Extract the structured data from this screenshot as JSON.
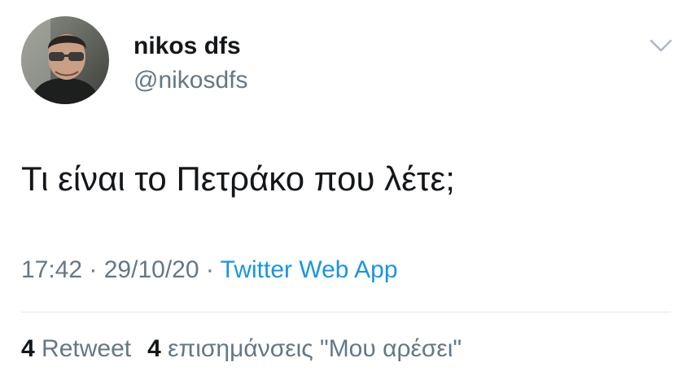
{
  "user": {
    "display_name": "nikos dfs",
    "handle": "@nikosdfs",
    "avatar_icon": "profile-photo"
  },
  "menu": {
    "icon": "chevron-down-icon"
  },
  "tweet": {
    "text": "Τι είναι το Πετράκο που λέτε;"
  },
  "meta": {
    "time": "17:42",
    "sep1": " · ",
    "date": "29/10/20",
    "sep2": " · ",
    "source": "Twitter Web App"
  },
  "stats": {
    "retweet_count": "4",
    "retweet_label": "Retweet",
    "likes_count": "4",
    "likes_label": "επισημάνσεις \"Μου αρέσει\""
  },
  "colors": {
    "text": "#14171a",
    "secondary": "#657786",
    "link": "#1b95e0",
    "divider": "#e1e8ed"
  }
}
